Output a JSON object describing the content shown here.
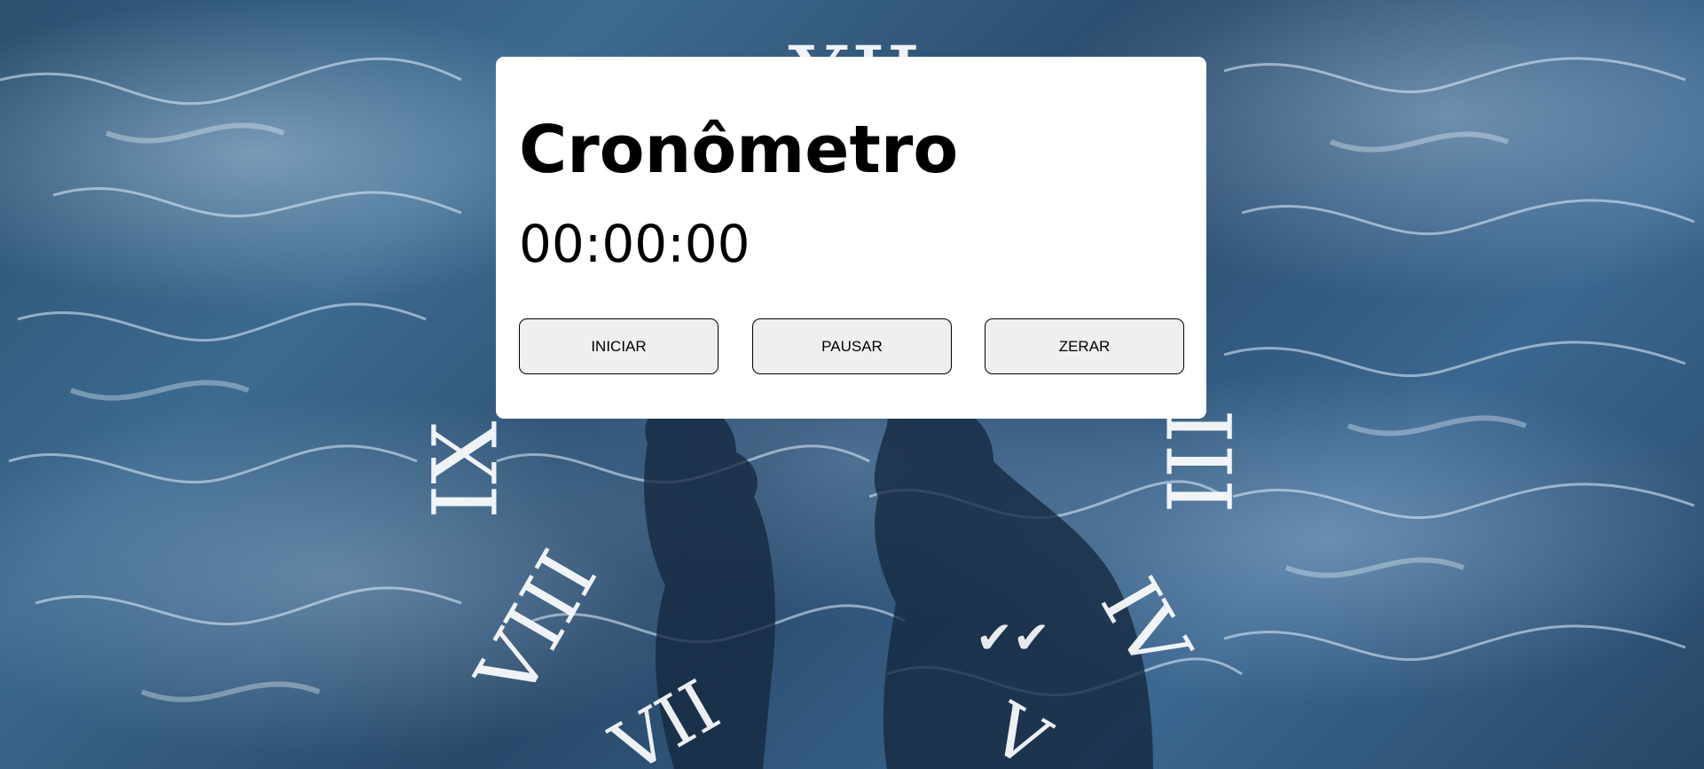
{
  "app": {
    "title": "Cronômetro",
    "time_display": "00:00:00"
  },
  "controls": {
    "start_label": "INICIAR",
    "pause_label": "PAUSAR",
    "reset_label": "ZERAR"
  },
  "background": {
    "clock_numerals": [
      "XII",
      "IX",
      "III",
      "VIII",
      "IV",
      "VII",
      "V"
    ]
  },
  "colors": {
    "card_background": "#ffffff",
    "button_background": "#efefef",
    "text": "#000000",
    "background_water": "#2f5678"
  },
  "icons": {
    "check": "double-check-icon"
  }
}
